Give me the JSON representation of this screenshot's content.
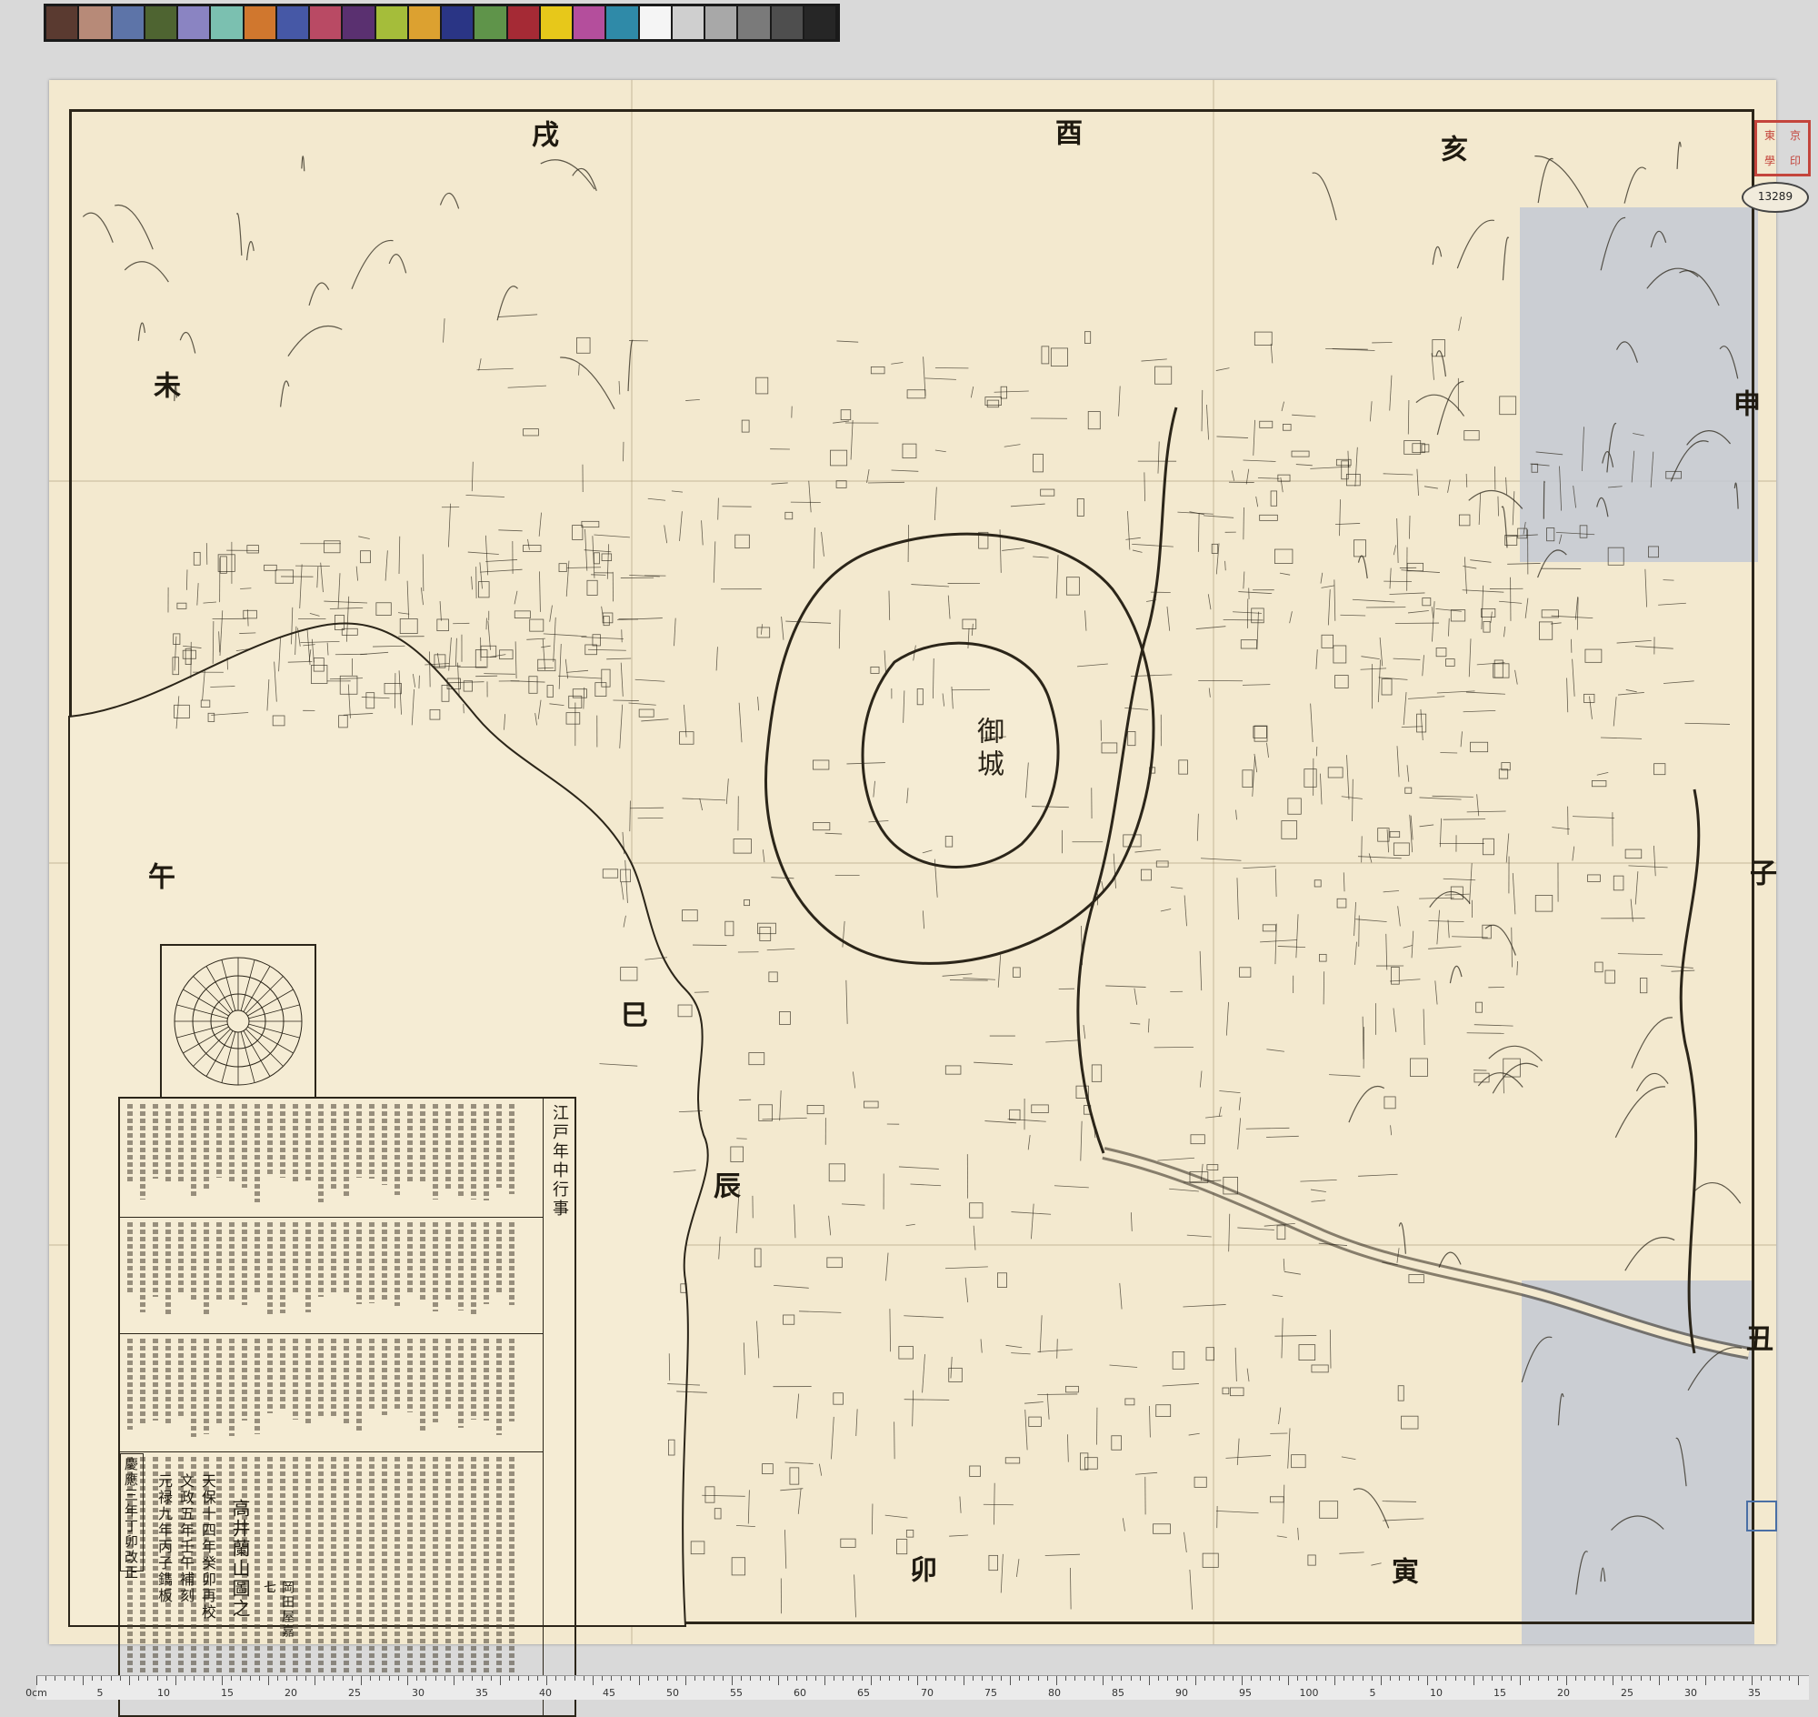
{
  "color_strip": {
    "swatches": [
      "#5a3a30",
      "#b78a78",
      "#5d74a8",
      "#4e6431",
      "#8a84c2",
      "#7bc0b0",
      "#d0772e",
      "#4658a6",
      "#b94a64",
      "#5a3070",
      "#a5bd3a",
      "#dca130",
      "#2a3585",
      "#5f944a",
      "#a52a35",
      "#e7c81a",
      "#b44e9c",
      "#2f8aa8",
      "#f5f5f5",
      "#cfcfcf",
      "#a8a8a8",
      "#7a7a7a",
      "#4e4e4e",
      "#262626"
    ]
  },
  "map": {
    "directions": {
      "north": "子",
      "south": "午",
      "ne": "丑",
      "ne2": "寅",
      "east": "卯",
      "se": "辰",
      "se2": "巳",
      "west": "酉",
      "nw": "戌",
      "nw2": "亥",
      "w2": "申",
      "sw": "未"
    },
    "castle": "御城",
    "notes_title": "江戸年中行事",
    "imprint": {
      "date": "慶應三年丁卯改正",
      "line1": "元禄九年丙子鐫板",
      "line2": "文政五年壬午補刻",
      "line3": "天保十四年癸卯再校",
      "author": "高井蘭山圖之",
      "publisher": "岡田屋嘉七"
    },
    "seal_chars": [
      "東",
      "京",
      "學",
      "印"
    ],
    "stamp_number": "13289"
  },
  "ruler": {
    "labels": [
      "0cm",
      "5",
      "10",
      "15",
      "20",
      "25",
      "30",
      "35",
      "40",
      "45",
      "50",
      "55",
      "60",
      "65",
      "70",
      "75",
      "80",
      "85",
      "90",
      "95",
      "100",
      "5",
      "10",
      "15",
      "20",
      "25",
      "30",
      "35"
    ]
  },
  "colors": {
    "paper": "#f3e9cf",
    "ink": "#2b2519",
    "seal": "#c4453c",
    "patch": "#c3c9d3"
  }
}
